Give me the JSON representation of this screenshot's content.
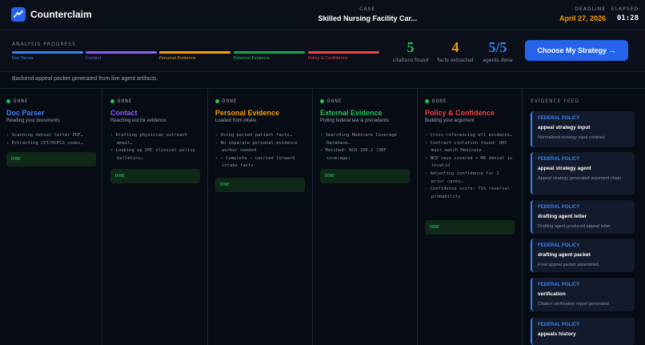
{
  "header": {
    "brand": "Counterclaim",
    "case_label": "CASE",
    "case_value": "Skilled Nursing Facility Car...",
    "deadline_label": "DEADLINE",
    "deadline_value": "April 27, 2026",
    "elapsed_label": "ELAPSED",
    "elapsed_value": "01:28"
  },
  "progress": {
    "title": "ANALYSIS PROGRESS",
    "segments": [
      {
        "label": "Doc Parser",
        "color": "#3b82f6"
      },
      {
        "label": "Contact",
        "color": "#8b5cf6"
      },
      {
        "label": "Personal Evidence",
        "color": "#f59e0b"
      },
      {
        "label": "External Evidence",
        "color": "#16a34a"
      },
      {
        "label": "Policy & Confidence",
        "color": "#ef4444"
      }
    ],
    "stats": [
      {
        "value": "5",
        "label": "citations found",
        "color": "#22c55e"
      },
      {
        "value": "4",
        "label": "facts extracted",
        "color": "#f59e0b"
      },
      {
        "value": "5/5",
        "label": "agents done",
        "color": "#3b82f6"
      }
    ],
    "strategy_button": "Choose My Strategy →"
  },
  "subtitle": "Backend appeal packet generated from live agent artifacts.",
  "columns": [
    {
      "status": "DONE",
      "title": "Doc Parser",
      "title_color": "#3b82f6",
      "subtitle": "Reading your documents",
      "lines": [
        "› Scanning denial letter PDF…",
        "› Extracting CPT/HCPCS codes…"
      ],
      "done": "DONE"
    },
    {
      "status": "DONE",
      "title": "Contact",
      "title_color": "#8b5cf6",
      "subtitle": "Reaching out for evidence",
      "lines": [
        "› Drafting physician outreach email…",
        "› Looking up UHC clinical policy bulletins…"
      ],
      "done": "DONE"
    },
    {
      "status": "DONE",
      "title": "Personal Evidence",
      "title_color": "#f59e0b",
      "subtitle": "Loaded from intake",
      "lines": [
        "› Using parsed patient facts…",
        "› No separate personal-evidence worker needed",
        "› ✓ Complete — carried forward intake facts"
      ],
      "done": "DONE"
    },
    {
      "status": "DONE",
      "title": "External Evidence",
      "title_color": "#22c55e",
      "subtitle": "Pulling federal law & precedents",
      "lines": [
        "› Searching Medicare Coverage Database…",
        "› Matched: NCD 100.2 (SNF coverage)"
      ],
      "done": "DONE"
    },
    {
      "status": "DONE",
      "title": "Policy & Confidence",
      "title_color": "#ef4444",
      "subtitle": "Building your argument",
      "lines": [
        "› Cross-referencing all evidence…",
        "› Contract violation found: UHC must match Medicare",
        "› NCD says covered → MA denial is invalid",
        "› Adjusting confidence for 2 prior cases…",
        "› Confidence score: 71% reversal probability"
      ],
      "done": "DONE"
    }
  ],
  "feed": {
    "title": "EVIDENCE FEED",
    "cards": [
      {
        "tag": "FEDERAL POLICY",
        "title": "appeal strategy input",
        "desc": "Normalized strategy input contract"
      },
      {
        "tag": "FEDERAL POLICY",
        "title": "appeal strategy agent",
        "desc": "Appeal strategy generated argument chain"
      },
      {
        "tag": "FEDERAL POLICY",
        "title": "drafting agent letter",
        "desc": "Drafting agent produced appeal letter"
      },
      {
        "tag": "FEDERAL POLICY",
        "title": "drafting agent packet",
        "desc": "Final appeal packet assembled"
      },
      {
        "tag": "FEDERAL POLICY",
        "title": "verification",
        "desc": "Citation verification report generated"
      },
      {
        "tag": "FEDERAL POLICY",
        "title": "appeals history",
        "desc": ""
      }
    ]
  }
}
